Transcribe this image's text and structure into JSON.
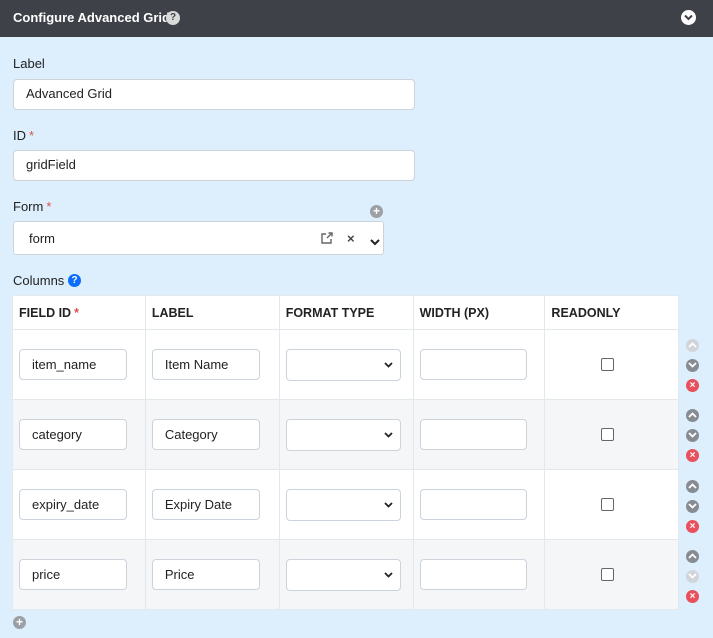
{
  "header": {
    "title": "Configure Advanced Grid",
    "help_glyph": "?"
  },
  "label_field": {
    "label": "Label",
    "value": "Advanced Grid"
  },
  "id_field": {
    "label": "ID",
    "required": "*",
    "value": "gridField"
  },
  "form_field": {
    "label": "Form",
    "required": "*",
    "value": "form",
    "clear_glyph": "×"
  },
  "columns": {
    "label": "Columns",
    "help_glyph": "?",
    "headers": {
      "field_id": "FIELD ID",
      "field_id_required": "*",
      "label": "LABEL",
      "format_type": "FORMAT TYPE",
      "width": "WIDTH (PX)",
      "readonly": "READONLY"
    },
    "rows": [
      {
        "field_id": "item_name",
        "label": "Item Name",
        "format_type": "",
        "width": "",
        "readonly": false
      },
      {
        "field_id": "category",
        "label": "Category",
        "format_type": "",
        "width": "",
        "readonly": false
      },
      {
        "field_id": "expiry_date",
        "label": "Expiry Date",
        "format_type": "",
        "width": "",
        "readonly": false
      },
      {
        "field_id": "price",
        "label": "Price",
        "format_type": "",
        "width": "",
        "readonly": false
      }
    ]
  },
  "icons": {
    "add": "plus-circle-icon",
    "move_up": "chevron-up-icon",
    "move_down": "chevron-down-icon",
    "delete": "times-circle-icon"
  },
  "colors": {
    "header_bg": "#3e4248",
    "panel_bg": "#ddeefc",
    "required": "#d9534f",
    "help": "#0d6efd",
    "delete": "#e8505b"
  }
}
